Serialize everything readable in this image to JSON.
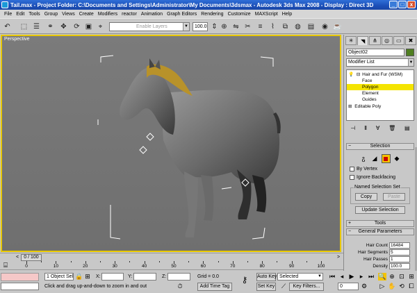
{
  "window": {
    "title": "Tail.max    - Project Folder: C:\\Documents and Settings\\Administrator\\My Documents\\3dsmax    - Autodesk 3ds Max 2008    - Display : Direct 3D",
    "buttons": [
      "_",
      "□",
      "x"
    ]
  },
  "menu": [
    "File",
    "Edit",
    "Tools",
    "Group",
    "Views",
    "Create",
    "Modifiers",
    "reactor",
    "Animation",
    "Graph Editors",
    "Rendering",
    "Customize",
    "MAXScript",
    "Help"
  ],
  "toolbar": {
    "selection_set_placeholder": "Enable Layers",
    "percent_value": "100.0"
  },
  "viewport": {
    "label": "Perspective",
    "border_color": "#e8c800"
  },
  "command_panel": {
    "object_name": "Object02",
    "object_color": "#4f7f20",
    "modifier_list_label": "Modifier List",
    "stack": {
      "hair_modifier": "Hair and Fur (WSM)",
      "sub_objects": [
        "Face",
        "Polygon",
        "Element",
        "Guides"
      ],
      "selected_sub_object": "Polygon",
      "base_object": "Editable Poly"
    },
    "selection_rollout": {
      "title": "Selection",
      "by_vertex": "By Vertex",
      "ignore_backfacing": "Ignore Backfacing",
      "named_sel_title": "Named Selection Set",
      "copy": "Copy",
      "paste": "Paste",
      "update_selection": "Update Selection"
    },
    "tools_rollout": "Tools",
    "general_params_rollout": "General Parameters",
    "params": [
      {
        "label": "Hair Count",
        "value": "16484"
      },
      {
        "label": "Hair Segments",
        "value": "5"
      },
      {
        "label": "Hair Passes",
        "value": "1"
      },
      {
        "label": "Density",
        "value": "100.0"
      }
    ]
  },
  "timeline": {
    "frame_display": "0 / 100",
    "ticks": [
      "0",
      "10",
      "20",
      "30",
      "40",
      "50",
      "60",
      "70",
      "80",
      "90",
      "100"
    ]
  },
  "status": {
    "selection_count": "1 Object Sele",
    "prompt": "Click and drag up-and-down to zoom in and out",
    "x_label": "X:",
    "y_label": "Y:",
    "z_label": "Z:",
    "grid": "Grid = 0.0",
    "add_time_tag": "Add Time Tag",
    "auto_key": "Auto Key",
    "set_key": "Set Key",
    "key_mode": "Selected",
    "key_filters": "Key Filters...",
    "frame": "0"
  }
}
